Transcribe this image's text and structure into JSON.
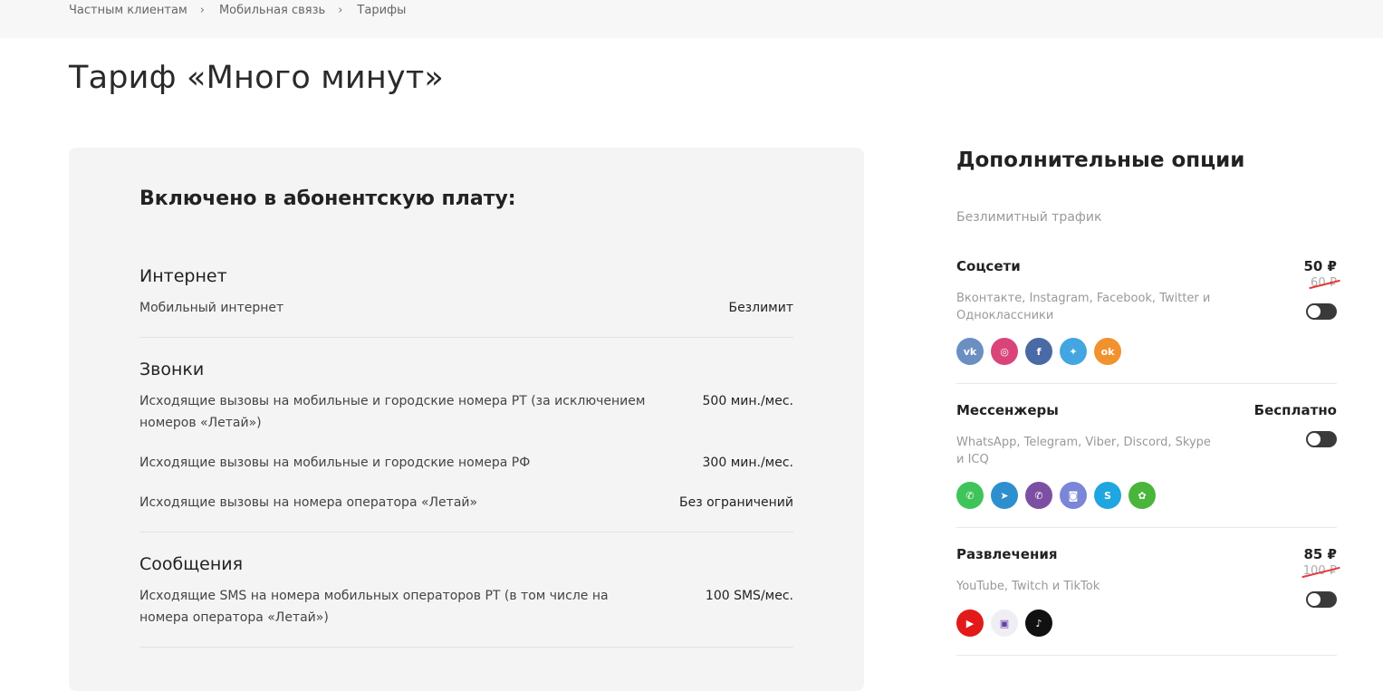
{
  "breadcrumb": [
    "Частным клиентам",
    "Мобильная связь",
    "Тарифы"
  ],
  "page_title": "Тариф «Много минут»",
  "included": {
    "heading": "Включено в абонентскую плату:",
    "sections": [
      {
        "title": "Интернет",
        "rows": [
          {
            "label": "Мобильный интернет",
            "value": "Безлимит"
          }
        ]
      },
      {
        "title": "Звонки",
        "rows": [
          {
            "label": "Исходящие вызовы на мобильные и городские номера РТ (за исключением номеров «Летай»)",
            "value": "500 мин./мес."
          },
          {
            "label": "Исходящие вызовы на мобильные и городские номера РФ",
            "value": "300 мин./мес."
          },
          {
            "label": "Исходящие вызовы на номера оператора «Летай»",
            "value": "Без ограничений"
          }
        ]
      },
      {
        "title": "Сообщения",
        "rows": [
          {
            "label": "Исходящие SMS на номера мобильных операторов РТ (в том числе на номера оператора «Летай»)",
            "value": "100 SMS/мес."
          }
        ]
      }
    ]
  },
  "options": {
    "heading": "Дополнительные опции",
    "subheading": "Безлимитный трафик",
    "items": [
      {
        "name": "Соцсети",
        "description": "Вконтакте, Instagram, Facebook, Twitter и Одноклассники",
        "price": "50 ₽",
        "old_price": "60 ₽",
        "icons": [
          {
            "name": "vk-icon",
            "glyph": "vk",
            "color": "#6c8fc2"
          },
          {
            "name": "instagram-icon",
            "glyph": "◎",
            "color": "#d9457a"
          },
          {
            "name": "facebook-icon",
            "glyph": "f",
            "color": "#4a6aa5"
          },
          {
            "name": "twitter-icon",
            "glyph": "✦",
            "color": "#43a6e0"
          },
          {
            "name": "odnoklassniki-icon",
            "glyph": "ok",
            "color": "#f2922e"
          }
        ]
      },
      {
        "name": "Мессенжеры",
        "description": "WhatsApp, Telegram, Viber, Discord, Skype и ICQ",
        "price": "Бесплатно",
        "icons": [
          {
            "name": "whatsapp-icon",
            "glyph": "✆",
            "color": "#3fc45a"
          },
          {
            "name": "telegram-icon",
            "glyph": "➤",
            "color": "#2e8fcf"
          },
          {
            "name": "viber-icon",
            "glyph": "✆",
            "color": "#7d4fa3"
          },
          {
            "name": "discord-icon",
            "glyph": "◙",
            "color": "#7a86d6"
          },
          {
            "name": "skype-icon",
            "glyph": "S",
            "color": "#1fa6e0"
          },
          {
            "name": "icq-icon",
            "glyph": "✿",
            "color": "#49b53a"
          }
        ]
      },
      {
        "name": "Развлечения",
        "description": "YouTube, Twitch и TikTok",
        "price": "85 ₽",
        "old_price": "100 ₽",
        "icons": [
          {
            "name": "youtube-icon",
            "glyph": "▶",
            "color": "#e21a1a"
          },
          {
            "name": "twitch-icon",
            "glyph": "▣",
            "color": "#f0eef5"
          },
          {
            "name": "tiktok-icon",
            "glyph": "♪",
            "color": "#111111"
          }
        ]
      }
    ]
  }
}
